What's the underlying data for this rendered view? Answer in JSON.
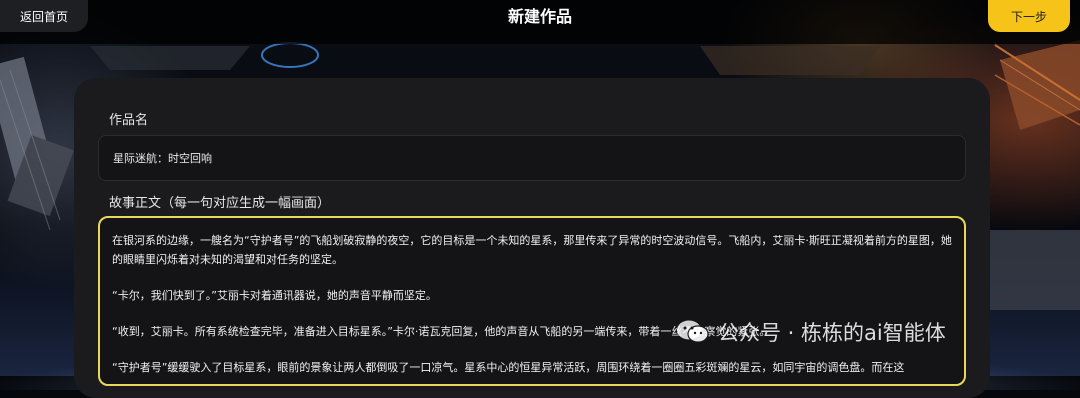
{
  "header": {
    "back_label": "返回首页",
    "title": "新建作品",
    "next_label": "下一步"
  },
  "form": {
    "name_label": "作品名",
    "name_value": "星际迷航：时空回响",
    "story_label": "故事正文（每一句对应生成一幅画面）",
    "story_paragraphs": [
      "在银河系的边缘，一艘名为“守护者号”的飞船划破寂静的夜空，它的目标是一个未知的星系，那里传来了异常的时空波动信号。飞船内，艾丽卡·斯旺正凝视着前方的星图，她的眼睛里闪烁着对未知的渴望和对任务的坚定。",
      "“卡尔，我们快到了。”艾丽卡对着通讯器说，她的声音平静而坚定。",
      "“收到，艾丽卡。所有系统检查完毕，准备进入目标星系。”卡尔·诺瓦克回复，他的声音从飞船的另一端传来，带着一丝不易察觉的紧张。",
      "“守护者号”缓缓驶入了目标星系，眼前的景象让两人都倒吸了一口凉气。星系中心的恒星异常活跃，周围环绕着一圈圈五彩斑斓的星云，如同宇宙的调色盘。而在这"
    ]
  },
  "watermark": {
    "text": "公众号 · 栋栋的ai智能体",
    "icon": "wechat-icon"
  },
  "colors": {
    "accent": "#f6c318",
    "focus_border": "#e9d85a",
    "panel": "#1b1b1d"
  }
}
